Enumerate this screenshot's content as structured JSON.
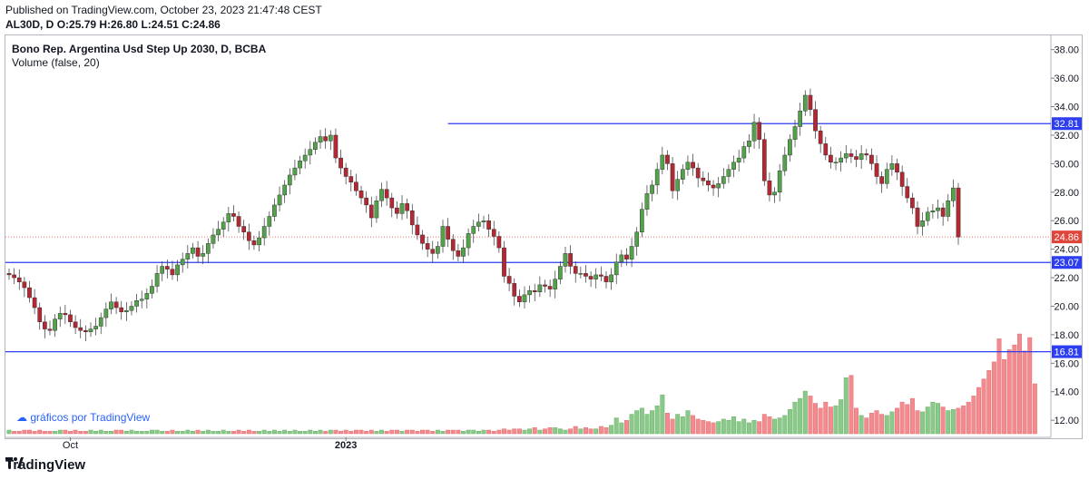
{
  "header": {
    "published": "Published on TradingView.com, October 23, 2023 21:47:48 CEST",
    "symbol": "AL30D, D",
    "open": "O:25.79",
    "high": "H:26.80",
    "low": "L:24.51",
    "close": "C:24.86"
  },
  "legend": {
    "instrument": "Bono Rep. Argentina Usd Step Up 2030, D, BCBA",
    "volume": "Volume (false, 20)"
  },
  "watermark": "gráficos por TradingView",
  "footer_brand": "TradingView",
  "colors": {
    "up": "#26a69a",
    "up_candle": "#53a14a",
    "down": "#b22833",
    "vol_up": "#8bc98a",
    "vol_down": "#f28b8f",
    "hline": "#2c3ef0",
    "price": "#e0453c"
  },
  "chart_data": {
    "type": "candlestick",
    "title": "Bono Rep. Argentina Usd Step Up 2030, D, BCBA",
    "y_ticks": [
      "12.00",
      "14.00",
      "16.00",
      "18.00",
      "20.00",
      "22.00",
      "24.00",
      "26.00",
      "28.00",
      "30.00",
      "32.00",
      "34.00",
      "36.00",
      "38.00"
    ],
    "ylim": [
      10.8,
      39.0
    ],
    "x_ticks": [
      {
        "label": "Oct",
        "index": 12
      },
      {
        "label": "2023",
        "index": 66
      }
    ],
    "price_scale_labels": [
      {
        "value": 32.81,
        "label": "32.81",
        "kind": "line"
      },
      {
        "value": 24.86,
        "label": "24.86",
        "kind": "last"
      },
      {
        "value": 23.07,
        "label": "23.07",
        "kind": "line"
      },
      {
        "value": 16.81,
        "label": "16.81",
        "kind": "line"
      }
    ],
    "horizontal_lines": [
      {
        "value": 32.81,
        "from_index": 86
      },
      {
        "value": 23.07,
        "from_index": 0
      },
      {
        "value": 16.81,
        "from_index": 0
      }
    ],
    "last_price": 24.86,
    "close_series": [
      22.2,
      22.0,
      21.7,
      21.3,
      20.6,
      19.9,
      18.9,
      18.4,
      18.3,
      19.1,
      19.5,
      19.4,
      18.9,
      18.5,
      18.3,
      18.2,
      18.4,
      18.6,
      19.2,
      19.8,
      20.3,
      19.9,
      19.6,
      19.7,
      20.0,
      20.4,
      20.5,
      20.9,
      21.4,
      22.3,
      22.8,
      22.6,
      22.2,
      22.9,
      23.3,
      23.7,
      24.1,
      23.5,
      23.7,
      24.4,
      25.0,
      25.4,
      25.9,
      26.5,
      26.3,
      25.6,
      25.2,
      24.6,
      24.3,
      24.8,
      25.6,
      26.3,
      27.1,
      27.8,
      28.5,
      29.2,
      29.7,
      30.2,
      30.6,
      31.0,
      31.5,
      31.9,
      31.6,
      32.0,
      30.4,
      29.7,
      29.1,
      28.7,
      28.1,
      27.6,
      27.1,
      26.2,
      27.4,
      28.2,
      27.6,
      26.9,
      26.5,
      27.2,
      26.7,
      25.7,
      25.0,
      24.4,
      24.0,
      23.7,
      24.2,
      25.6,
      24.7,
      23.9,
      23.5,
      24.1,
      25.1,
      25.6,
      25.9,
      26.0,
      25.4,
      24.9,
      24.1,
      22.1,
      21.6,
      20.7,
      20.3,
      20.8,
      21.1,
      21.0,
      21.5,
      21.4,
      21.2,
      21.9,
      22.8,
      23.7,
      22.8,
      22.3,
      22.3,
      22.1,
      21.9,
      22.2,
      22.1,
      21.7,
      22.2,
      23.1,
      23.6,
      23.3,
      24.2,
      25.2,
      26.8,
      27.9,
      28.5,
      29.6,
      30.6,
      30.0,
      28.1,
      28.9,
      29.6,
      30.1,
      29.7,
      29.0,
      28.8,
      28.5,
      28.3,
      28.6,
      29.1,
      29.6,
      30.1,
      30.4,
      31.2,
      31.6,
      32.9,
      31.7,
      28.8,
      27.8,
      28.0,
      29.5,
      30.6,
      31.7,
      32.6,
      33.7,
      34.8,
      33.8,
      32.3,
      31.4,
      30.6,
      30.1,
      30.1,
      30.4,
      30.7,
      30.5,
      30.3,
      30.7,
      30.6,
      30.0,
      29.1,
      28.6,
      29.6,
      30.0,
      29.4,
      28.4,
      27.6,
      26.9,
      25.6,
      26.0,
      26.6,
      26.7,
      26.9,
      26.3,
      27.4,
      28.3,
      24.86
    ],
    "volume_series": [
      0.3,
      0.2,
      0.2,
      0.3,
      0.3,
      0.2,
      0.3,
      0.2,
      0.2,
      0.2,
      0.3,
      0.3,
      0.2,
      0.3,
      0.2,
      0.2,
      0.3,
      0.2,
      0.3,
      0.2,
      0.2,
      0.3,
      0.3,
      0.2,
      0.3,
      0.2,
      0.2,
      0.2,
      0.3,
      0.3,
      0.2,
      0.2,
      0.3,
      0.2,
      0.2,
      0.3,
      0.2,
      0.3,
      0.2,
      0.3,
      0.2,
      0.2,
      0.3,
      0.2,
      0.2,
      0.3,
      0.2,
      0.3,
      0.2,
      0.2,
      0.3,
      0.2,
      0.3,
      0.2,
      0.3,
      0.2,
      0.3,
      0.2,
      0.2,
      0.3,
      0.2,
      0.3,
      0.2,
      0.3,
      0.3,
      0.2,
      0.3,
      0.2,
      0.3,
      0.3,
      0.2,
      0.3,
      0.2,
      0.3,
      0.2,
      0.3,
      0.3,
      0.2,
      0.3,
      0.3,
      0.2,
      0.3,
      0.3,
      0.2,
      0.3,
      0.2,
      0.3,
      0.3,
      0.3,
      0.2,
      0.3,
      0.3,
      0.2,
      0.3,
      0.3,
      0.2,
      0.3,
      0.4,
      0.3,
      0.4,
      0.4,
      0.3,
      0.4,
      0.5,
      0.3,
      0.4,
      0.5,
      0.5,
      0.4,
      0.3,
      0.4,
      0.6,
      0.4,
      0.5,
      0.4,
      0.4,
      0.6,
      0.5,
      0.7,
      1.3,
      0.9,
      1.1,
      1.6,
      1.9,
      2.1,
      1.6,
      1.9,
      2.3,
      3.2,
      1.7,
      1.2,
      1.6,
      1.4,
      1.9,
      1.5,
      1.2,
      1.1,
      1.0,
      0.9,
      1.0,
      1.2,
      1.1,
      1.4,
      1.0,
      1.2,
      0.9,
      1.1,
      1.0,
      1.6,
      1.4,
      1.2,
      1.3,
      1.5,
      2.0,
      2.6,
      2.9,
      3.5,
      3.1,
      2.5,
      2.1,
      2.6,
      2.2,
      2.3,
      2.8,
      4.6,
      4.8,
      2.1,
      1.5,
      1.3,
      1.7,
      1.9,
      1.6,
      1.5,
      1.8,
      2.1,
      2.6,
      2.4,
      2.9,
      1.9,
      1.8,
      2.2,
      2.6,
      2.5,
      2.2,
      1.9,
      2.0,
      2.1,
      2.3,
      2.6,
      3.1,
      3.8,
      4.5,
      5.2,
      5.9,
      7.8,
      6.1,
      6.9,
      7.3,
      8.2,
      6.8,
      7.9,
      4.1
    ]
  }
}
